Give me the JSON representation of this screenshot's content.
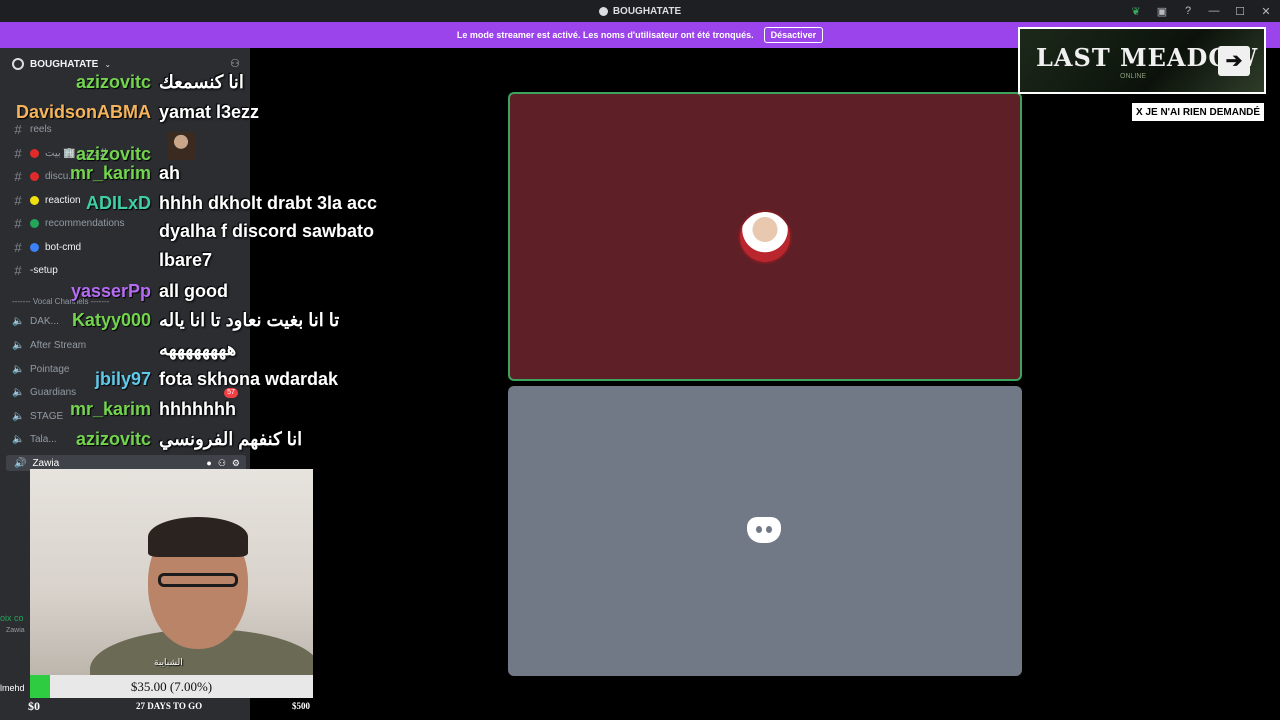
{
  "window": {
    "title": "BOUGHATATE"
  },
  "banner": {
    "text": "Le mode streamer est activé. Les noms d'utilisateur ont été tronqués.",
    "button": "Désactiver"
  },
  "sidebar": {
    "server_name": "BOUGHATATE",
    "channels": [
      {
        "label": "reels",
        "icon": "hash-icon"
      },
      {
        "label": "الخزين 🏢 بيت",
        "icon": "hash-icon",
        "dot": "#e02b2b"
      },
      {
        "label": "discu...",
        "icon": "hash-icon",
        "dot": "#e02b2b"
      },
      {
        "label": "reaction",
        "icon": "hash-icon",
        "dot": "#f0e010"
      },
      {
        "label": "recommendations",
        "icon": "hash-icon",
        "dot": "#23a55a"
      },
      {
        "label": "bot-cmd",
        "icon": "hash-icon",
        "dot": "#3b82f6"
      },
      {
        "label": "-setup",
        "icon": "hash-icon"
      }
    ],
    "voice_header": "------- Vocal Channels -------",
    "voice_channels": [
      {
        "label": "DAK..."
      },
      {
        "label": "After Stream"
      },
      {
        "label": "Pointage"
      },
      {
        "label": "Guardians"
      },
      {
        "label": "STAGE"
      },
      {
        "label": "Tala..."
      }
    ],
    "badge": "57",
    "active_voice": "Zawia"
  },
  "chat": [
    {
      "user": "azizovitc",
      "color": "#73d44d",
      "text": "انا كنسمعك"
    },
    {
      "user": "DavidsonABMA",
      "color": "#f5b45a",
      "text": "yamat l3ezz"
    },
    {
      "user": "azizovitc",
      "color": "#73d44d",
      "text": ""
    },
    {
      "user": "mr_karim",
      "color": "#73d44d",
      "text": "ah"
    },
    {
      "user": "ADILxD",
      "color": "#3fcfa5",
      "text": "hhhh dkholt drabt 3la acc"
    },
    {
      "user": "",
      "color": "#fff",
      "text": "dyalha f discord sawbato"
    },
    {
      "user": "",
      "color": "#fff",
      "text": "lbare7"
    },
    {
      "user": "yasserPp",
      "color": "#b36cf2",
      "text": "all good"
    },
    {
      "user": "Katyy000",
      "color": "#73d44d",
      "text": "تا انا بغيت نعاود تا انا ياله"
    },
    {
      "user": "",
      "color": "#fff",
      "text": "ههههههههه"
    },
    {
      "user": "jbily97",
      "color": "#5fc9ea",
      "text": "fota skhona wdardak"
    },
    {
      "user": "mr_karim",
      "color": "#73d44d",
      "text": "hhhhhhh"
    },
    {
      "user": "azizovitc",
      "color": "#73d44d",
      "text": "انا كنفهم الفرونسي"
    }
  ],
  "overlay": {
    "game_title": "LAST MEADOW",
    "game_sub": "ONLINE",
    "notice": "X JE N'AI RIEN DEMANDÉ"
  },
  "webcam": {
    "caption": "الشبايبة"
  },
  "goal": {
    "label": "$35.00 (7.00%)",
    "progress_fraction": 0.07,
    "min": "$0",
    "days": "27 DAYS TO GO",
    "max": "$500",
    "fill_color": "#2ecc40"
  },
  "side_fragments": {
    "voice": "oix co",
    "user": "Zawia",
    "name": "lmehd"
  }
}
